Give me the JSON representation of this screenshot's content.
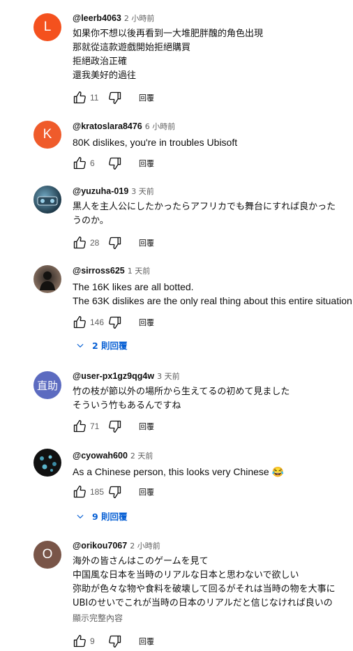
{
  "reply_label": "回覆",
  "comments": [
    {
      "author": "@leerb4063",
      "time": "2 小時前",
      "avatar_letter": "L",
      "avatar_color": "#f4511e",
      "lines": [
        "如果你不想以後再看到一大堆肥胖醜的角色出現",
        "那就從這款遊戲開始拒絕購買",
        "拒絕政治正確",
        "還我美好的過往"
      ],
      "likes": "11"
    },
    {
      "author": "@kratoslara8476",
      "time": "6 小時前",
      "avatar_letter": "K",
      "avatar_color": "#ef5b2b",
      "lines": [
        "80K dislikes, you're in troubles Ubisoft"
      ],
      "likes": "6"
    },
    {
      "author": "@yuzuha-019",
      "time": "3 天前",
      "avatar_letter": "",
      "avatar_color": "#1f3a4a",
      "lines": [
        "黒人を主人公にしたかったらアフリカでも舞台にすれば良かった",
        "うのか。"
      ],
      "likes": "28"
    },
    {
      "author": "@sirross625",
      "time": "1 天前",
      "avatar_letter": "",
      "avatar_color": "#5a4a40",
      "lines": [
        "The 16K likes are all botted.",
        "The 63K dislikes are the only real thing about this entire situation."
      ],
      "likes": "146",
      "replies": "2 則回覆"
    },
    {
      "author": "@user-px1gz9qg4w",
      "time": "3 天前",
      "avatar_letter": "直助",
      "avatar_color": "#5c6bc0",
      "lines": [
        "竹の枝が節以外の場所から生えてるの初めて見ました",
        "そういう竹もあるんですね"
      ],
      "likes": "71"
    },
    {
      "author": "@cyowah600",
      "time": "2 天前",
      "avatar_letter": "",
      "avatar_color": "#1a1a1a",
      "lines": [
        "As a Chinese person, this looks very Chinese 😂"
      ],
      "likes": "185",
      "replies": "9 則回覆"
    },
    {
      "author": "@orikou7067",
      "time": "2 小時前",
      "avatar_letter": "O",
      "avatar_color": "#795548",
      "lines": [
        "海外の皆さんはこのゲームを見て",
        "中国風な日本を当時のリアルな日本と思わないで欲しい",
        "弥助が色々な物や食料を破壊して回るがそれは当時の物を大事に",
        "UBIのせいでこれが当時の日本のリアルだと信じなければ良いの"
      ],
      "more": "顯示完整內容",
      "likes": "9"
    }
  ]
}
